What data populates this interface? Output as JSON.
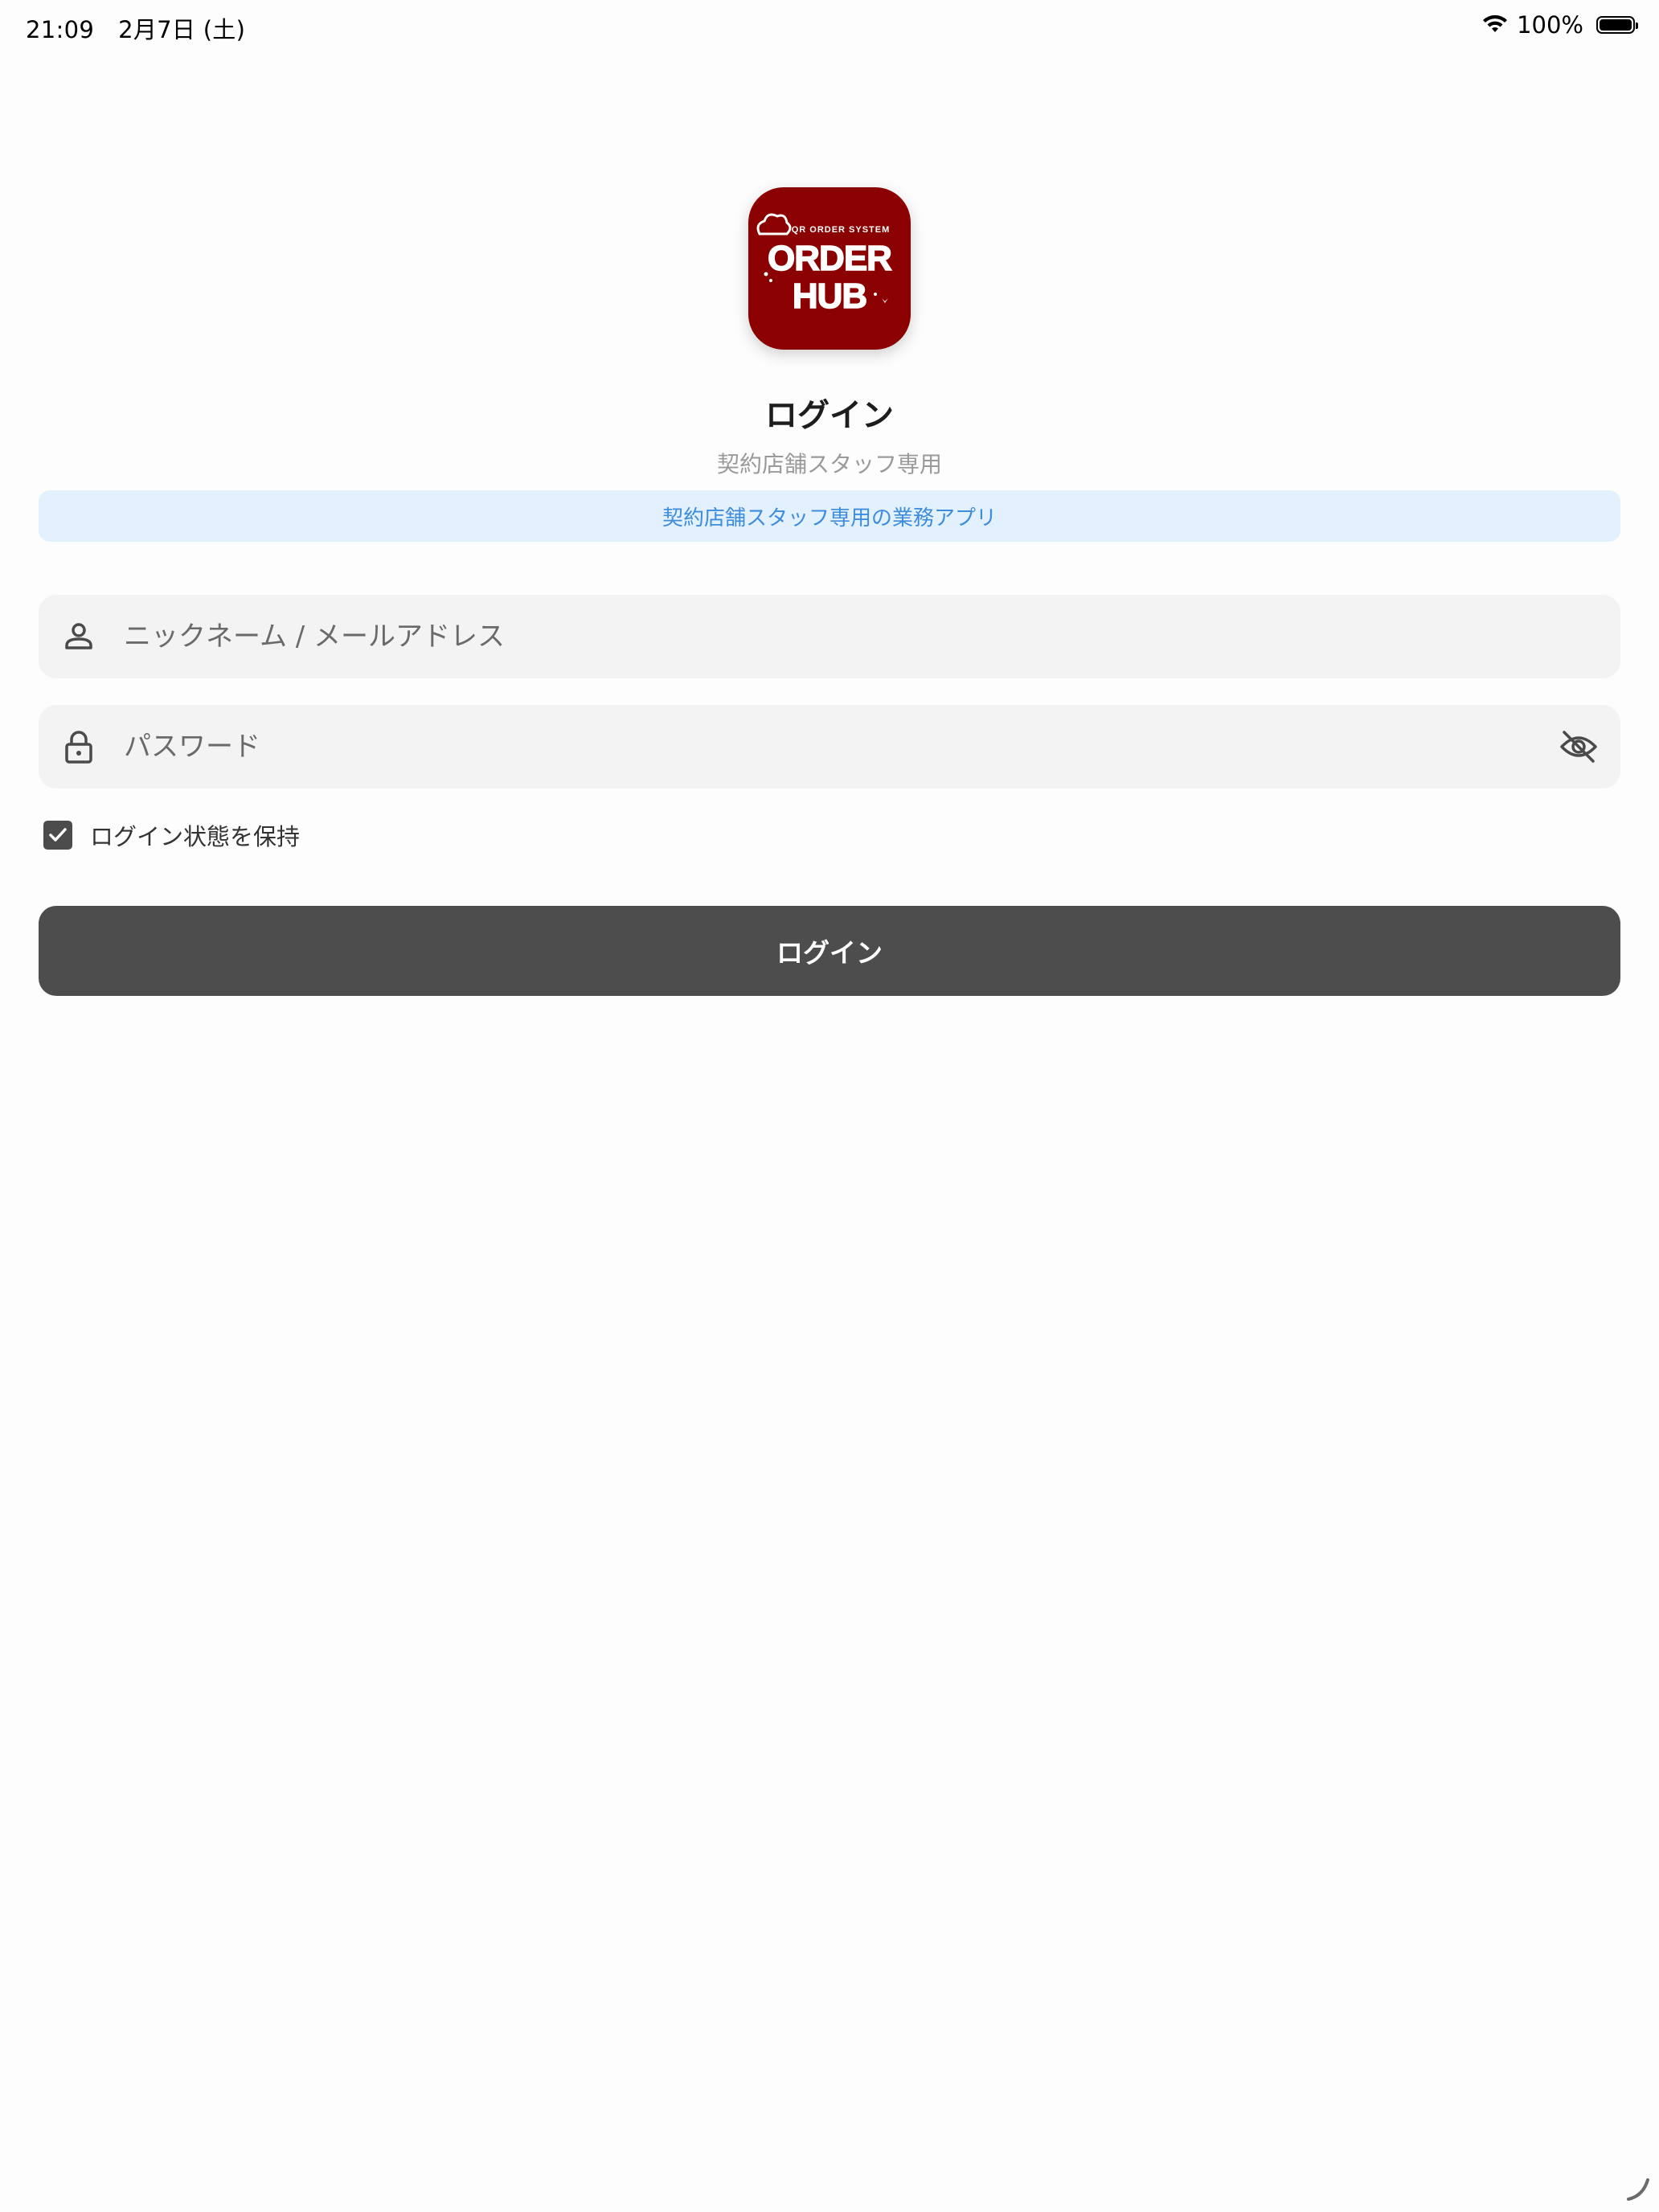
{
  "status_bar": {
    "time": "21:09",
    "date": "2月7日 (土)",
    "battery": "100%",
    "battery_level": 1.0,
    "icons": [
      "wifi-icon",
      "battery-icon"
    ]
  },
  "logo": {
    "top_text": "QR ORDER SYSTEM",
    "line1": "ORDER",
    "line2": "HUB",
    "background_color": "#8b0000"
  },
  "header": {
    "title": "ログイン",
    "subtitle": "契約店舗スタッフ専用",
    "banner": "契約店舗スタッフ専用の業務アプリ"
  },
  "form": {
    "username": {
      "placeholder": "ニックネーム / メールアドレス",
      "value": "",
      "icon": "person-icon"
    },
    "password": {
      "placeholder": "パスワード",
      "value": "",
      "icon": "lock-icon",
      "toggle_icon": "eye-off-icon"
    },
    "remember": {
      "label": "ログイン状態を保持",
      "checked": true
    },
    "submit_label": "ログイン"
  },
  "colors": {
    "banner_bg": "#e3f0fd",
    "banner_text": "#3d8ddc",
    "button_bg": "#4d4d4d",
    "field_bg": "#f3f3f3"
  }
}
